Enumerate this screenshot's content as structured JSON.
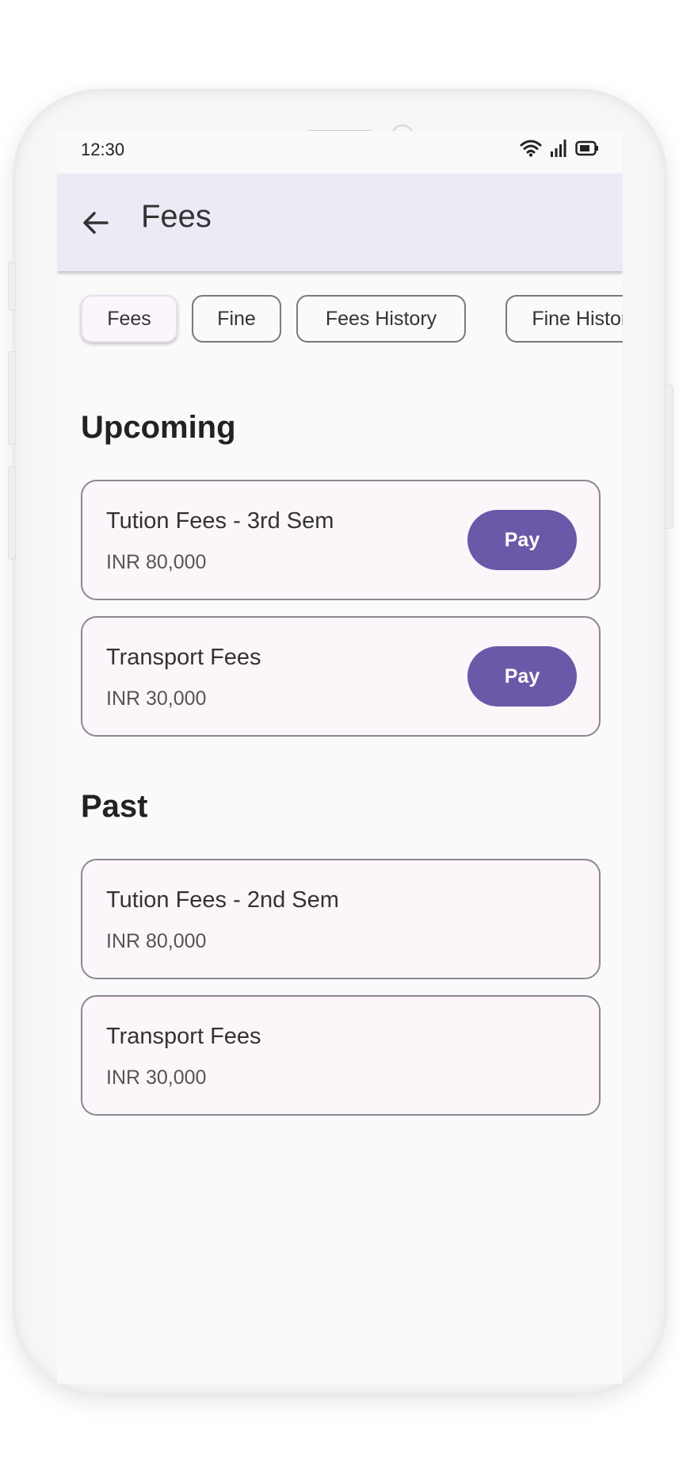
{
  "status_bar": {
    "time": "12:30",
    "icons": [
      "wifi-icon",
      "signal-icon",
      "battery-icon"
    ]
  },
  "app_bar": {
    "back_icon": "arrow-left-icon",
    "title": "Fees"
  },
  "tabs": [
    {
      "label": "Fees",
      "selected": true
    },
    {
      "label": "Fine",
      "selected": false
    },
    {
      "label": "Fees History",
      "selected": false
    },
    {
      "label": "Fine History",
      "selected": false
    }
  ],
  "sections": {
    "upcoming": {
      "title": "Upcoming",
      "items": [
        {
          "title": "Tution Fees - 3rd Sem",
          "amount": "INR 80,000",
          "action": "Pay"
        },
        {
          "title": "Transport Fees",
          "amount": "INR 30,000",
          "action": "Pay"
        }
      ]
    },
    "past": {
      "title": "Past",
      "items": [
        {
          "title": "Tution Fees - 2nd Sem",
          "amount": "INR 80,000"
        },
        {
          "title": "Transport Fees",
          "amount": "INR 30,000"
        }
      ]
    }
  },
  "colors": {
    "accent": "#6c58a8",
    "app_bar_bg": "#eeeaf5",
    "card_bg": "#fcf6fb"
  }
}
